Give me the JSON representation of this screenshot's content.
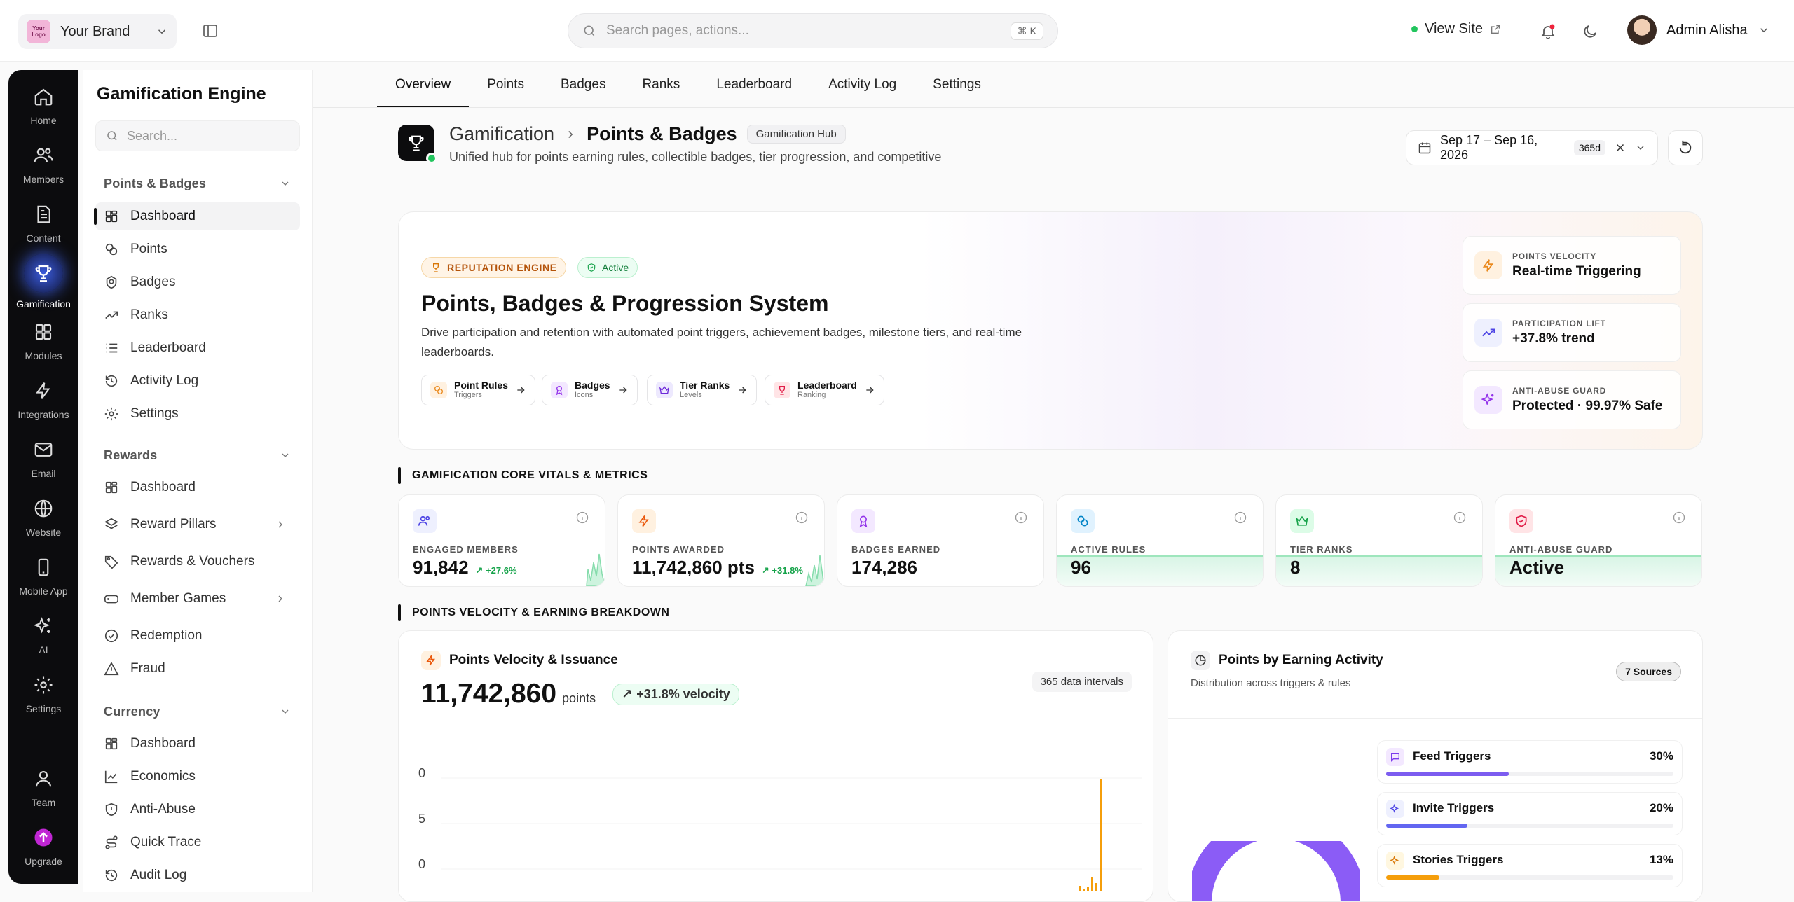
{
  "topbar": {
    "brand_logo": "Your Logo",
    "brand_name": "Your Brand",
    "search_placeholder": "Search pages, actions...",
    "search_shortcut": "⌘ K",
    "view_site": "View Site",
    "user_name": "Admin Alisha"
  },
  "rail": {
    "items": [
      {
        "label": "Home",
        "icon": "home-icon"
      },
      {
        "label": "Members",
        "icon": "members-icon"
      },
      {
        "label": "Content",
        "icon": "document-icon"
      },
      {
        "label": "Gamification",
        "icon": "trophy-icon"
      },
      {
        "label": "Modules",
        "icon": "grid-icon"
      },
      {
        "label": "Integrations",
        "icon": "bolt-icon"
      },
      {
        "label": "Email",
        "icon": "mail-icon"
      },
      {
        "label": "Website",
        "icon": "globe-icon"
      },
      {
        "label": "Mobile App",
        "icon": "phone-icon"
      },
      {
        "label": "AI",
        "icon": "sparkles-icon"
      },
      {
        "label": "Settings",
        "icon": "gear-icon"
      },
      {
        "label": "Team",
        "icon": "team-icon"
      },
      {
        "label": "Upgrade",
        "icon": "upgrade-icon"
      }
    ]
  },
  "sidebar": {
    "title": "Gamification Engine",
    "search_placeholder": "Search...",
    "sections": [
      {
        "title": "Points & Badges",
        "items": [
          "Dashboard",
          "Points",
          "Badges",
          "Ranks",
          "Leaderboard",
          "Activity Log",
          "Settings"
        ]
      },
      {
        "title": "Rewards",
        "items": [
          "Dashboard",
          "Reward Pillars",
          "Rewards & Vouchers",
          "Member Games",
          "Redemption",
          "Fraud"
        ]
      },
      {
        "title": "Currency",
        "items": [
          "Dashboard",
          "Economics",
          "Anti-Abuse",
          "Quick Trace",
          "Audit Log"
        ]
      }
    ]
  },
  "tabs": [
    "Overview",
    "Points",
    "Badges",
    "Ranks",
    "Leaderboard",
    "Activity Log",
    "Settings"
  ],
  "header": {
    "crumb_parent": "Gamification",
    "crumb_current": "Points & Badges",
    "badge": "Gamification Hub",
    "subtitle": "Unified hub for points earning rules, collectible badges, tier progression, and competitive",
    "date_range": "Sep 17 – Sep 16, 2026",
    "days": "365d"
  },
  "hero": {
    "pill_engine": "REPUTATION ENGINE",
    "pill_status": "Active",
    "title": "Points, Badges & Progression System",
    "description": "Drive participation and retention with automated point triggers, achievement badges, milestone tiers, and real-time leaderboards.",
    "chips": [
      {
        "title": "Point Rules",
        "sub": "Triggers"
      },
      {
        "title": "Badges",
        "sub": "Icons"
      },
      {
        "title": "Tier Ranks",
        "sub": "Levels"
      },
      {
        "title": "Leaderboard",
        "sub": "Ranking"
      }
    ],
    "cards": [
      {
        "label": "POINTS VELOCITY",
        "value": "Real-time Triggering"
      },
      {
        "label": "PARTICIPATION LIFT",
        "value": "+37.8% trend"
      },
      {
        "label": "ANTI-ABUSE GUARD",
        "value": "Protected · 99.97% Safe"
      }
    ]
  },
  "vitals": {
    "title": "GAMIFICATION CORE VITALS & METRICS",
    "cards": [
      {
        "label": "ENGAGED MEMBERS",
        "value": "91,842",
        "trend": "+27.6%"
      },
      {
        "label": "POINTS AWARDED",
        "value": "11,742,860 pts",
        "trend": "+31.8%"
      },
      {
        "label": "BADGES EARNED",
        "value": "174,286",
        "trend": ""
      },
      {
        "label": "ACTIVE RULES",
        "value": "96",
        "trend": ""
      },
      {
        "label": "TIER RANKS",
        "value": "8",
        "trend": ""
      },
      {
        "label": "ANTI-ABUSE GUARD",
        "value": "Active",
        "trend": ""
      }
    ]
  },
  "velocity_section": {
    "title": "POINTS VELOCITY & EARNING BREAKDOWN",
    "panel_title": "Points Velocity & Issuance",
    "total": "11,742,860",
    "unit": "points",
    "velocity": "+31.8% velocity",
    "intervals": "365 data intervals",
    "axis_labels": [
      "0",
      "5",
      "0"
    ]
  },
  "chart_data": {
    "type": "bar",
    "series": [
      {
        "values": [
          0.4,
          0.2,
          0.3,
          1.0,
          0.6,
          8.0
        ]
      }
    ],
    "ylabels_shown": [
      "0",
      "5",
      "0"
    ]
  },
  "earning": {
    "title": "Points by Earning Activity",
    "subtitle": "Distribution across triggers & rules",
    "sources_badge": "7 Sources",
    "items": [
      {
        "name": "Feed Triggers",
        "pct": "30%",
        "value": 30,
        "color": "#7c5cf0"
      },
      {
        "name": "Invite Triggers",
        "pct": "20%",
        "value": 20,
        "color": "#6366f1"
      },
      {
        "name": "Stories Triggers",
        "pct": "13%",
        "value": 13,
        "color": "#f59e0b"
      }
    ]
  }
}
